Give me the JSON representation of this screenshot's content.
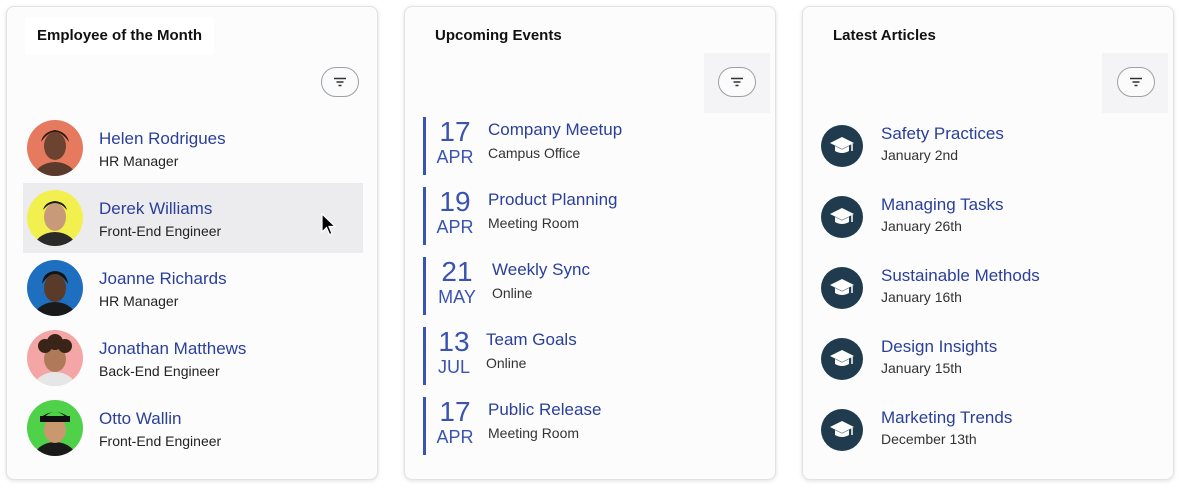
{
  "employees_card": {
    "title": "Employee of the Month",
    "items": [
      {
        "name": "Helen Rodrigues",
        "role": "HR Manager",
        "avatar_color": "#e57a5f"
      },
      {
        "name": "Derek Williams",
        "role": "Front-End Engineer",
        "avatar_color": "#f2f04e"
      },
      {
        "name": "Joanne Richards",
        "role": "HR Manager",
        "avatar_color": "#1e6fbf"
      },
      {
        "name": "Jonathan Matthews",
        "role": "Back-End Engineer",
        "avatar_color": "#f4a6a6"
      },
      {
        "name": "Otto Wallin",
        "role": "Front-End Engineer",
        "avatar_color": "#4fd14a"
      }
    ]
  },
  "events_card": {
    "title": "Upcoming Events",
    "items": [
      {
        "day": "17",
        "month": "APR",
        "title": "Company Meetup",
        "location": "Campus Office"
      },
      {
        "day": "19",
        "month": "APR",
        "title": "Product Planning",
        "location": "Meeting Room"
      },
      {
        "day": "21",
        "month": "MAY",
        "title": "Weekly Sync",
        "location": "Online"
      },
      {
        "day": "13",
        "month": "JUL",
        "title": "Team Goals",
        "location": "Online"
      },
      {
        "day": "17",
        "month": "APR",
        "title": "Public Release",
        "location": "Meeting Room"
      }
    ]
  },
  "articles_card": {
    "title": "Latest Articles",
    "items": [
      {
        "title": "Safety Practices",
        "date": "January 2nd"
      },
      {
        "title": "Managing Tasks",
        "date": "January 26th"
      },
      {
        "title": "Sustainable Methods",
        "date": "January 16th"
      },
      {
        "title": "Design Insights",
        "date": "January 15th"
      },
      {
        "title": "Marketing Trends",
        "date": "December 13th"
      }
    ]
  },
  "icons": {
    "filter": "filter-icon",
    "article": "graduation-cap-icon",
    "cursor": "mouse-pointer-icon"
  },
  "colors": {
    "accent": "#2a3f9a",
    "event_bar": "#3a53b0",
    "article_icon_bg": "#1f3b4d",
    "selected_row": "#ececee"
  }
}
